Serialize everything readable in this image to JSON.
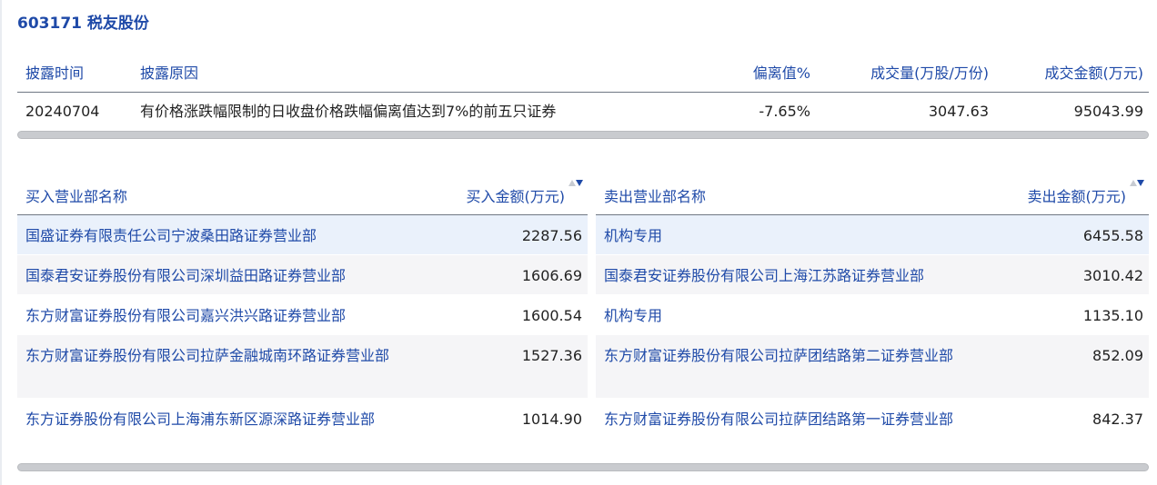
{
  "title": "603171 税友股份",
  "disclosure": {
    "headers": {
      "date": "披露时间",
      "reason": "披露原因",
      "deviation": "偏离值%",
      "volume": "成交量(万股/万份)",
      "amount": "成交金额(万元)"
    },
    "rows": [
      {
        "date": "20240704",
        "reason": "有价格涨跌幅限制的日收盘价格跌幅偏离值达到7%的前五只证券",
        "deviation": "-7.65%",
        "volume": "3047.63",
        "amount": "95043.99"
      }
    ]
  },
  "buy": {
    "headers": {
      "name": "买入营业部名称",
      "amount": "买入金额(万元)"
    },
    "rows": [
      {
        "name": "国盛证券有限责任公司宁波桑田路证券营业部",
        "amount": "2287.56"
      },
      {
        "name": "国泰君安证券股份有限公司深圳益田路证券营业部",
        "amount": "1606.69"
      },
      {
        "name": "东方财富证券股份有限公司嘉兴洪兴路证券营业部",
        "amount": "1600.54"
      },
      {
        "name": "东方财富证券股份有限公司拉萨金融城南环路证券营业部",
        "amount": "1527.36"
      },
      {
        "name": "东方证券股份有限公司上海浦东新区源深路证券营业部",
        "amount": "1014.90"
      }
    ]
  },
  "sell": {
    "headers": {
      "name": "卖出营业部名称",
      "amount": "卖出金额(万元)"
    },
    "rows": [
      {
        "name": "机构专用",
        "amount": "6455.58"
      },
      {
        "name": "国泰君安证券股份有限公司上海江苏路证券营业部",
        "amount": "3010.42"
      },
      {
        "name": "机构专用",
        "amount": "1135.10"
      },
      {
        "name": "东方财富证券股份有限公司拉萨团结路第二证券营业部",
        "amount": "852.09"
      },
      {
        "name": "东方财富证券股份有限公司拉萨团结路第一证券营业部",
        "amount": "842.37"
      }
    ]
  },
  "colors": {
    "accent": "#1f4aa8",
    "highlight_row": "#eaf1fb",
    "zebra_row": "#f5f5f7"
  },
  "icons": {
    "sort": "sort-up-down-icon"
  }
}
